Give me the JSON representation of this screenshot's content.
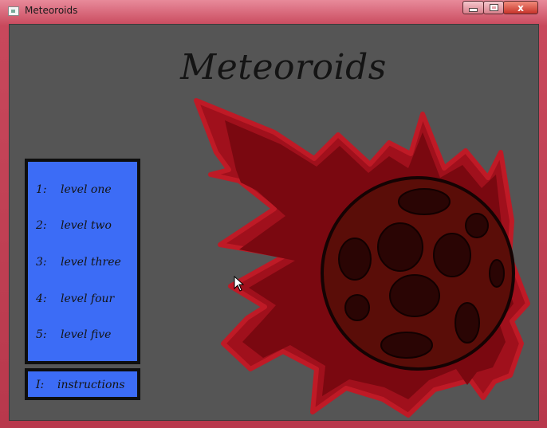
{
  "window": {
    "title": "Meteoroids",
    "close_glyph": "x"
  },
  "game": {
    "title": "Meteoroids",
    "levels": [
      {
        "key": "1:",
        "label": "level one"
      },
      {
        "key": "2:",
        "label": "level two"
      },
      {
        "key": "3:",
        "label": "level three"
      },
      {
        "key": "4:",
        "label": "level four"
      },
      {
        "key": "5:",
        "label": "level five"
      }
    ],
    "instructions": {
      "key": "I:",
      "label": "instructions"
    }
  },
  "colors": {
    "background": "#555555",
    "menu_panel": "#3c6cf6",
    "meteor_flame": "#a0101c",
    "meteor_body": "#5a0d08",
    "crater": "#2a0504"
  }
}
